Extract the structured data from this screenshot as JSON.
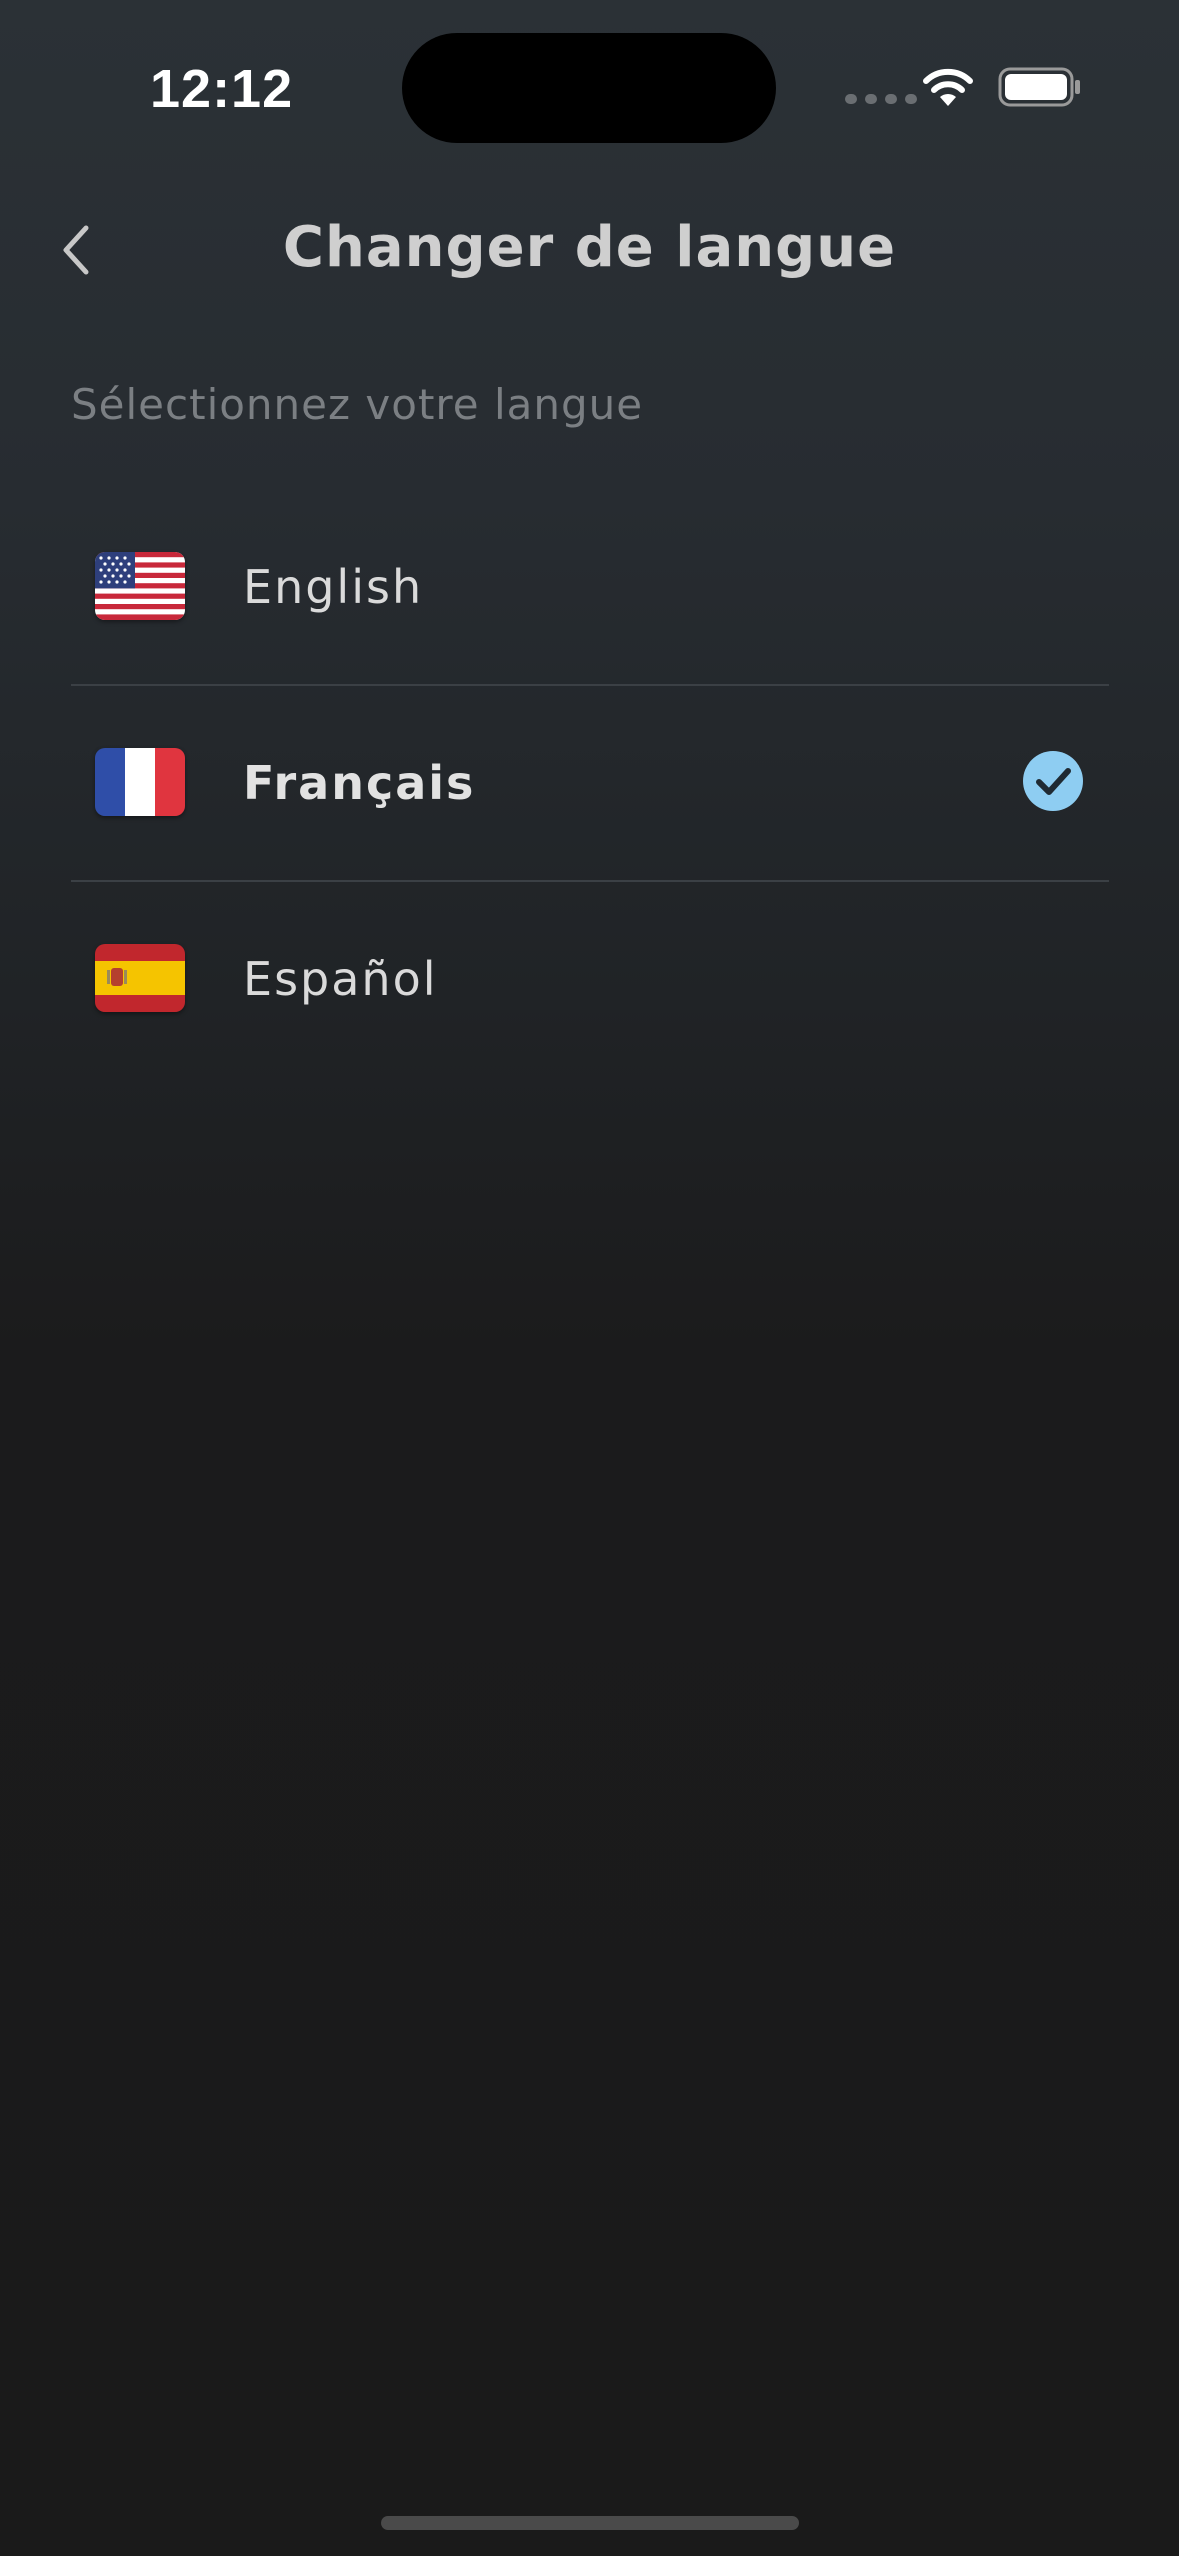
{
  "status_bar": {
    "time": "12:12"
  },
  "header": {
    "title": "Changer de langue",
    "back_icon": "chevron-left-icon"
  },
  "subtitle": "Sélectionnez votre langue",
  "languages": [
    {
      "label": "English",
      "flag": "us-flag-icon",
      "selected": false
    },
    {
      "label": "Français",
      "flag": "fr-flag-icon",
      "selected": true
    },
    {
      "label": "Español",
      "flag": "es-flag-icon",
      "selected": false
    }
  ],
  "colors": {
    "accent_check": "#8ecdf2",
    "background_top": "#2b3136",
    "background_bottom": "#1a1a1a"
  }
}
